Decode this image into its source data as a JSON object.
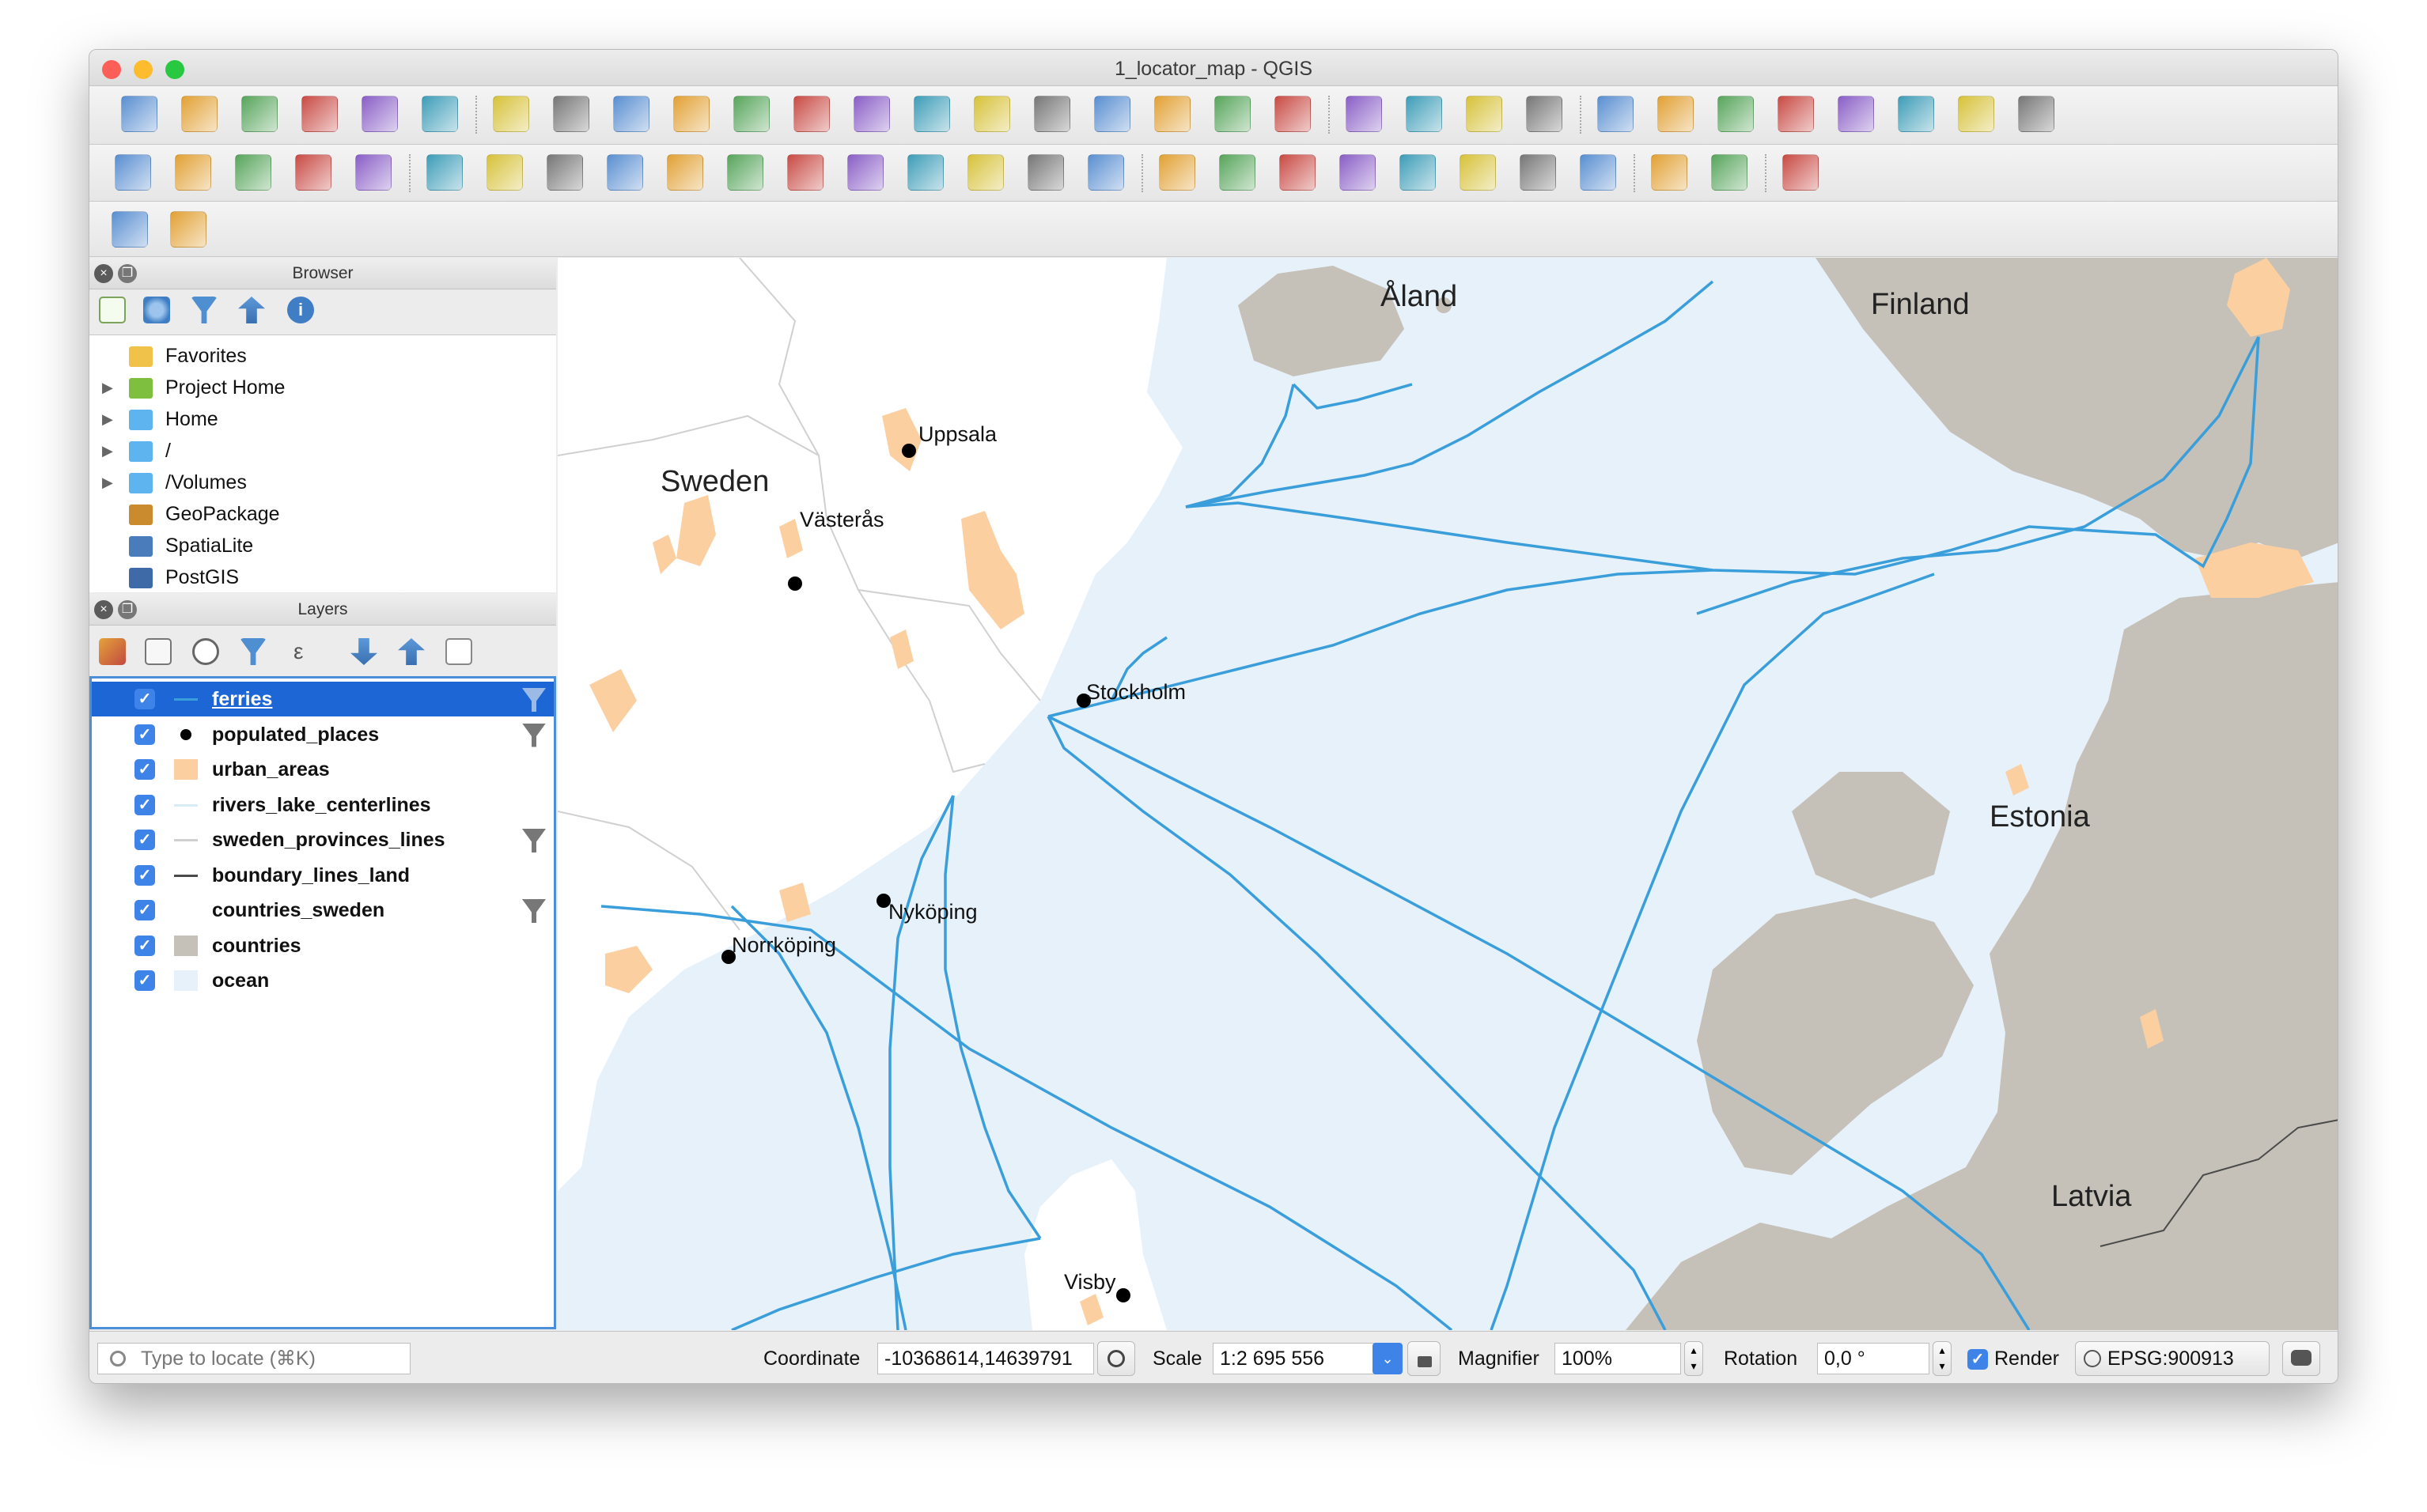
{
  "window": {
    "title": "1_locator_map - QGIS"
  },
  "toolbar": {
    "row1": [
      "new-project",
      "open-project",
      "save-project",
      "save-as",
      "new-print-layout",
      "layout-manager",
      "pan",
      "pan-to-selection",
      "zoom-in",
      "zoom-out",
      "zoom-native",
      "zoom-full",
      "zoom-to-selection",
      "zoom-to-layer",
      "zoom-last",
      "zoom-next",
      "new-bookmark",
      "show-bookmarks",
      "spatial-bookmarks",
      "refresh",
      "identify",
      "run-action",
      "select-features",
      "attribute-table-toggle",
      "deselect",
      "open-attribute-table",
      "field-calculator",
      "toolbox",
      "statistics",
      "measure",
      "map-tips",
      "text-annotation"
    ],
    "row2": [
      "data-source-manager",
      "new-geopackage-layer",
      "digitize-vertex",
      "digitize-line",
      "current-edits",
      "toggle-editing",
      "pencil-edit",
      "save-layer-edits",
      "vertex-tool",
      "move-feature",
      "node-tool",
      "delete-selected",
      "cut-features",
      "copy-features",
      "paste-features",
      "undo",
      "redo",
      "label-tool",
      "layer-labeling",
      "pin-labels",
      "show-hide-labels",
      "highlight-pinned",
      "move-label",
      "rotate-label",
      "change-label",
      "quickmap-services",
      "python-console",
      "help"
    ],
    "row3": [
      "georeferencer",
      "rotate-tool"
    ]
  },
  "browser": {
    "title": "Browser",
    "items": [
      {
        "label": "Favorites",
        "icon": "star-icon",
        "expandable": false
      },
      {
        "label": "Project Home",
        "icon": "project-home-icon",
        "expandable": true
      },
      {
        "label": "Home",
        "icon": "folder-icon",
        "expandable": true
      },
      {
        "label": "/",
        "icon": "folder-icon",
        "expandable": true
      },
      {
        "label": "/Volumes",
        "icon": "folder-icon",
        "expandable": true
      },
      {
        "label": "GeoPackage",
        "icon": "geopackage-icon",
        "expandable": false
      },
      {
        "label": "SpatiaLite",
        "icon": "spatialite-icon",
        "expandable": false
      },
      {
        "label": "PostGIS",
        "icon": "postgis-icon",
        "expandable": false
      }
    ]
  },
  "layers": {
    "title": "Layers",
    "items": [
      {
        "name": "ferries",
        "checked": true,
        "symbol": "line",
        "color": "#3a9edb",
        "filter": true,
        "selected": true
      },
      {
        "name": "populated_places",
        "checked": true,
        "symbol": "dot",
        "color": "#000000",
        "filter": true
      },
      {
        "name": "urban_areas",
        "checked": true,
        "symbol": "fill",
        "color": "#fbcfa0",
        "filter": false
      },
      {
        "name": "rivers_lake_centerlines",
        "checked": true,
        "symbol": "line",
        "color": "#d8ecf7",
        "filter": false
      },
      {
        "name": "sweden_provinces_lines",
        "checked": true,
        "symbol": "line",
        "color": "#d0d0d0",
        "filter": true
      },
      {
        "name": "boundary_lines_land",
        "checked": true,
        "symbol": "line",
        "color": "#4a4a4a",
        "filter": false
      },
      {
        "name": "countries_sweden",
        "checked": true,
        "symbol": "none",
        "color": "#ffffff",
        "filter": true
      },
      {
        "name": "countries",
        "checked": true,
        "symbol": "fill",
        "color": "#c5c0b8",
        "filter": false
      },
      {
        "name": "ocean",
        "checked": true,
        "symbol": "fill",
        "color": "#e6f1fa",
        "filter": false
      }
    ]
  },
  "map": {
    "labels": [
      {
        "text": "Åland",
        "cls": "country"
      },
      {
        "text": "Finland",
        "cls": "country"
      },
      {
        "text": "Sweden",
        "cls": "country"
      },
      {
        "text": "Estonia",
        "cls": "country"
      },
      {
        "text": "Latvia",
        "cls": "country"
      },
      {
        "text": "Uppsala",
        "cls": "city"
      },
      {
        "text": "Västerås",
        "cls": "city"
      },
      {
        "text": "Stockholm",
        "cls": "city"
      },
      {
        "text": "Nyköping",
        "cls": "city"
      },
      {
        "text": "Norrköping",
        "cls": "city"
      },
      {
        "text": "Visby",
        "cls": "city"
      }
    ],
    "colors": {
      "ocean": "#e6f1fa",
      "land": "#ffffff",
      "neighbours": "#c5c0b8",
      "urban": "#fbcfa0",
      "ferries": "#3a9edb"
    }
  },
  "statusbar": {
    "locator_placeholder": "Type to locate (⌘K)",
    "coordinate_label": "Coordinate",
    "coordinate": "-10368614,14639791",
    "scale_label": "Scale",
    "scale": "1:2 695 556",
    "magnifier_label": "Magnifier",
    "magnifier": "100%",
    "rotation_label": "Rotation",
    "rotation": "0,0 °",
    "render_label": "Render",
    "render_checked": true,
    "crs": "EPSG:900913"
  }
}
